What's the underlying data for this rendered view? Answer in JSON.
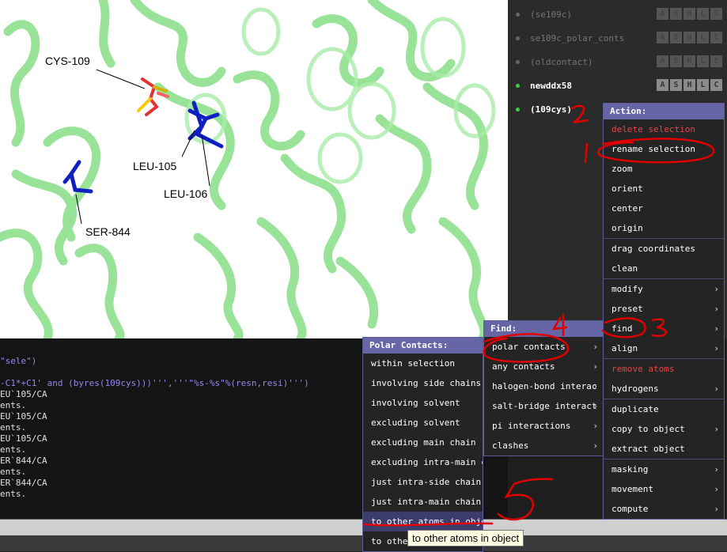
{
  "viewport": {
    "labels": {
      "cys109": "CYS-109",
      "leu105": "LEU-105",
      "leu106": "LEU-106",
      "ser844": "SER-844"
    }
  },
  "console": {
    "lines": [
      {
        "text": "\"sele\")",
        "kind": "cmd"
      },
      {
        "text": "",
        "kind": "out"
      },
      {
        "text": "-C1*+C1' and (byres(109cys)))''','''\"%s-%s\"%(resn,resi)''')",
        "kind": "cmd"
      },
      {
        "text": "EU`105/CA",
        "kind": "out"
      },
      {
        "text": "ents.",
        "kind": "out"
      },
      {
        "text": "EU`105/CA",
        "kind": "out"
      },
      {
        "text": "ents.",
        "kind": "out"
      },
      {
        "text": "EU`105/CA",
        "kind": "out"
      },
      {
        "text": "ents.",
        "kind": "out"
      },
      {
        "text": "ER`844/CA",
        "kind": "out"
      },
      {
        "text": "ents.",
        "kind": "out"
      },
      {
        "text": "ER`844/CA",
        "kind": "out"
      },
      {
        "text": "ents.",
        "kind": "out"
      }
    ]
  },
  "objects": [
    {
      "name": "(se109c)",
      "state": "dim"
    },
    {
      "name": "se109c_polar_conts",
      "state": "dim"
    },
    {
      "name": "(oldcontact)",
      "state": "dim"
    },
    {
      "name": "newddx58",
      "state": "on"
    },
    {
      "name": "(109cys)",
      "state": "on"
    }
  ],
  "object_buttons": [
    "A",
    "S",
    "H",
    "L",
    "C"
  ],
  "action_menu": {
    "title": "Action:",
    "items": [
      {
        "label": "delete selection",
        "red": true,
        "arrow": false
      },
      {
        "label": "rename selection",
        "red": false,
        "arrow": false
      },
      {
        "label": "zoom",
        "red": false,
        "arrow": false
      },
      {
        "label": "orient",
        "red": false,
        "arrow": false
      },
      {
        "label": "center",
        "red": false,
        "arrow": false
      },
      {
        "label": "origin",
        "red": false,
        "arrow": false
      },
      {
        "sep": true
      },
      {
        "label": "drag coordinates",
        "red": false,
        "arrow": false
      },
      {
        "label": "clean",
        "red": false,
        "arrow": false
      },
      {
        "sep": true
      },
      {
        "label": "modify",
        "red": false,
        "arrow": true
      },
      {
        "label": "preset",
        "red": false,
        "arrow": true
      },
      {
        "label": "find",
        "red": false,
        "arrow": true
      },
      {
        "label": "align",
        "red": false,
        "arrow": true
      },
      {
        "sep": true
      },
      {
        "label": "remove atoms",
        "red": true,
        "arrow": false
      },
      {
        "label": "hydrogens",
        "red": false,
        "arrow": true
      },
      {
        "sep": true
      },
      {
        "label": "duplicate",
        "red": false,
        "arrow": false
      },
      {
        "label": "copy to object",
        "red": false,
        "arrow": true
      },
      {
        "label": "extract object",
        "red": false,
        "arrow": false
      },
      {
        "sep": true
      },
      {
        "label": "masking",
        "red": false,
        "arrow": true
      },
      {
        "label": "movement",
        "red": false,
        "arrow": true
      },
      {
        "label": "compute",
        "red": false,
        "arrow": true
      }
    ]
  },
  "find_menu": {
    "title": "Find:",
    "items": [
      {
        "label": "polar contacts",
        "arrow": true
      },
      {
        "label": "any contacts",
        "arrow": true
      },
      {
        "label": "halogen-bond interac",
        "arrow": true
      },
      {
        "label": "salt-bridge interact",
        "arrow": true
      },
      {
        "label": "pi interactions",
        "arrow": true
      },
      {
        "label": "clashes",
        "arrow": true
      }
    ]
  },
  "polar_menu": {
    "title": "Polar Contacts:",
    "items": [
      {
        "label": "within selection"
      },
      {
        "label": "involving side chains"
      },
      {
        "label": "involving solvent"
      },
      {
        "label": "excluding solvent"
      },
      {
        "label": "excluding main chain"
      },
      {
        "label": "excluding intra-main c"
      },
      {
        "label": "just intra-side chain"
      },
      {
        "label": "just intra-main chain"
      },
      {
        "label": "to other atoms in obje"
      },
      {
        "label": "to other"
      }
    ]
  },
  "tooltip": "to other atoms in object",
  "annotations": [
    "1",
    "2",
    "3",
    "4",
    "5"
  ],
  "colors": {
    "protein": "#8ee08e",
    "menu_title": "#6666a6",
    "annotation": "#e00000",
    "red_item": "#e84444",
    "active_dot": "#3fd043"
  }
}
